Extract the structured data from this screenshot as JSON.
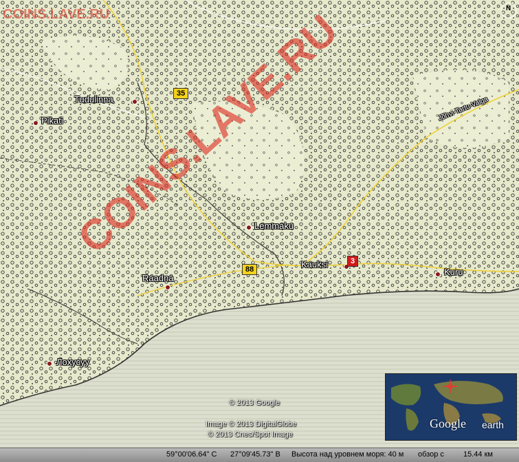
{
  "watermark_top": "COINS.LAVE.RU",
  "watermark_diag": "COINS.LAVE.RU",
  "places": [
    {
      "name": "Tudulinna"
    },
    {
      "name": "Pikati"
    },
    {
      "name": "Lemmaku"
    },
    {
      "name": "Kauksi"
    },
    {
      "name": "Raadna"
    },
    {
      "name": "Kuru"
    },
    {
      "name": "Лохусуу"
    }
  ],
  "road_shields": [
    {
      "number": "35"
    },
    {
      "number": "88"
    },
    {
      "number": "3"
    }
  ],
  "road_label": "Jõhvi-Tartu-Valga",
  "compass_letter": "N",
  "copyright": {
    "google": "© 2013 Google",
    "digitalglobe": "Image © 2013 DigitalGlobe",
    "cnes": "© 2013 Cnes/Spot Image"
  },
  "status": {
    "latitude": "59°00'06.64\" С",
    "longitude": "27°09'45.73\" В",
    "elevation": "Высота над уровнем моря: 40 м",
    "view_altitude": "обзор с",
    "distance": "15.44 км"
  },
  "overview": {
    "brand_google": "Google",
    "brand_earth": "earth"
  },
  "colors": {
    "map_paper": "#e4e8c8",
    "sea": "#d9dcc9",
    "watermark": "#dc281e",
    "road_yellow": "#f4d21a",
    "road_red": "#d21a1a"
  }
}
